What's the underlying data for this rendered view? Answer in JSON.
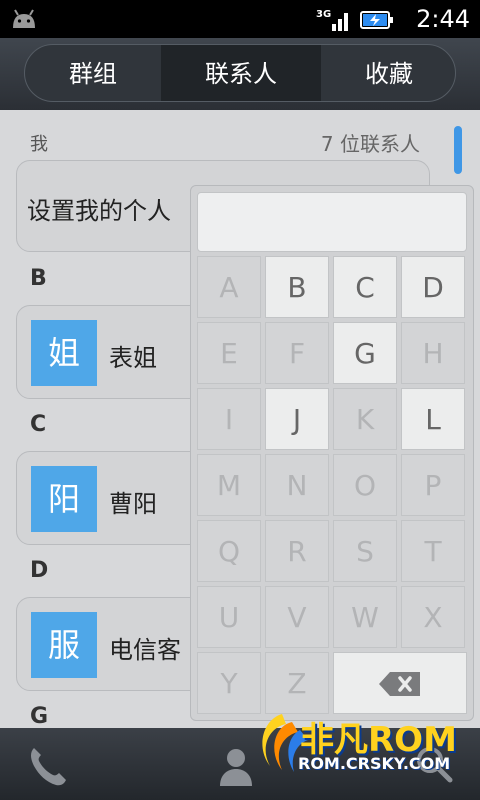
{
  "status_bar": {
    "network": "3G",
    "time": "2:44"
  },
  "tabs": [
    {
      "label": "群组",
      "active": false
    },
    {
      "label": "联系人",
      "active": true
    },
    {
      "label": "收藏",
      "active": false
    }
  ],
  "list": {
    "me_header": "我",
    "contact_count": "7 位联系人",
    "me_card_text": "设置我的个人",
    "sections": [
      {
        "letter": "B",
        "avatar": "姐",
        "name": "表姐"
      },
      {
        "letter": "C",
        "avatar": "阳",
        "name": "曹阳"
      },
      {
        "letter": "D",
        "avatar": "服",
        "name": "电信客"
      },
      {
        "letter": "G"
      }
    ]
  },
  "keyboard": {
    "input_value": "",
    "keys": [
      "A",
      "B",
      "C",
      "D",
      "E",
      "F",
      "G",
      "H",
      "I",
      "J",
      "K",
      "L",
      "M",
      "N",
      "O",
      "P",
      "Q",
      "R",
      "S",
      "T",
      "U",
      "V",
      "W",
      "X",
      "Y",
      "Z"
    ],
    "enabled_keys": [
      "B",
      "C",
      "D",
      "G",
      "J",
      "L"
    ]
  },
  "watermark": {
    "main": "非凡ROM",
    "sub": "ROM.CRSKY.COM"
  },
  "colors": {
    "accent": "#4fa7e8",
    "tab_bg": "#30353b",
    "background": "#d7d8da"
  },
  "icons": [
    "android-icon",
    "signal-3g-icon",
    "battery-charging-icon",
    "phone-icon",
    "contacts-icon",
    "search-icon",
    "backspace-icon"
  ]
}
